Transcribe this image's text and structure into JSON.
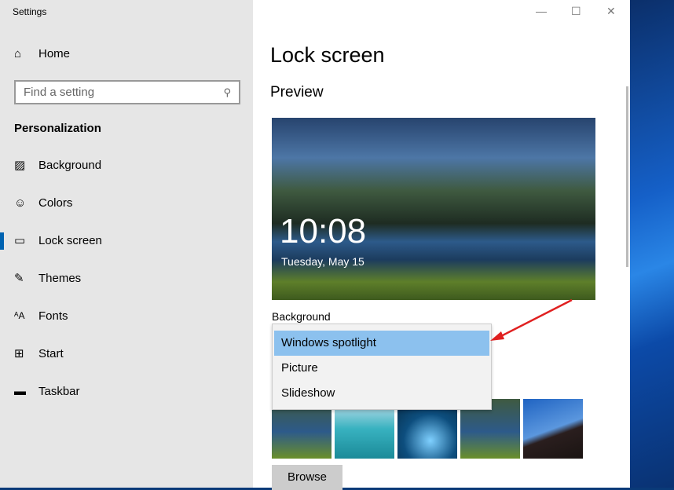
{
  "window": {
    "title": "Settings",
    "controls": [
      "minimize",
      "maximize",
      "close"
    ]
  },
  "sidebar": {
    "home": {
      "label": "Home",
      "icon": "home-icon"
    },
    "search": {
      "placeholder": "Find a setting",
      "icon": "search-icon"
    },
    "section": "Personalization",
    "items": [
      {
        "label": "Background",
        "icon": "picture-icon"
      },
      {
        "label": "Colors",
        "icon": "palette-icon"
      },
      {
        "label": "Lock screen",
        "icon": "lock-screen-icon",
        "selected": true
      },
      {
        "label": "Themes",
        "icon": "themes-icon"
      },
      {
        "label": "Fonts",
        "icon": "fonts-icon"
      },
      {
        "label": "Start",
        "icon": "start-icon"
      },
      {
        "label": "Taskbar",
        "icon": "taskbar-icon"
      }
    ]
  },
  "main": {
    "title": "Lock screen",
    "preview_heading": "Preview",
    "preview": {
      "time": "10:08",
      "date": "Tuesday, May 15"
    },
    "background_label": "Background",
    "dropdown": {
      "options": [
        "Windows spotlight",
        "Picture",
        "Slideshow"
      ],
      "selected": "Windows spotlight"
    },
    "browse_label": "Browse",
    "annotation_arrow_color": "#e02020",
    "accent": "#0063b1"
  }
}
